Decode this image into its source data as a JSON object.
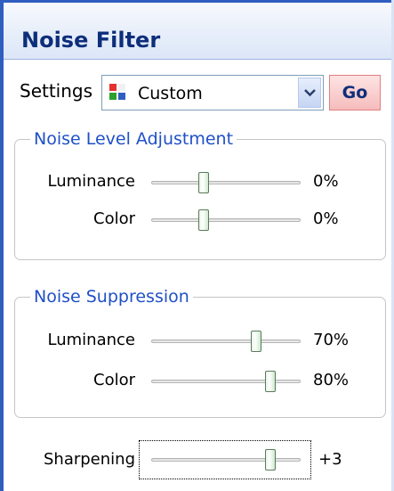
{
  "panel": {
    "title": "Noise Filter"
  },
  "settings": {
    "label": "Settings",
    "selected": "Custom",
    "icon": "preset-grid-icon",
    "go_label": "Go"
  },
  "noise_level": {
    "title": "Noise Level Adjustment",
    "luminance": {
      "label": "Luminance",
      "value": "0%",
      "position": 0.35
    },
    "color": {
      "label": "Color",
      "value": "0%",
      "position": 0.35
    }
  },
  "noise_suppression": {
    "title": "Noise Suppression",
    "luminance": {
      "label": "Luminance",
      "value": "70%",
      "position": 0.7
    },
    "color": {
      "label": "Color",
      "value": "80%",
      "position": 0.8
    }
  },
  "sharpening": {
    "label": "Sharpening",
    "value": "+3",
    "position": 0.8
  },
  "colors": {
    "accent": "#2f5ec0",
    "group_title": "#1f50c8",
    "go_bg": "#f6bcbc"
  }
}
